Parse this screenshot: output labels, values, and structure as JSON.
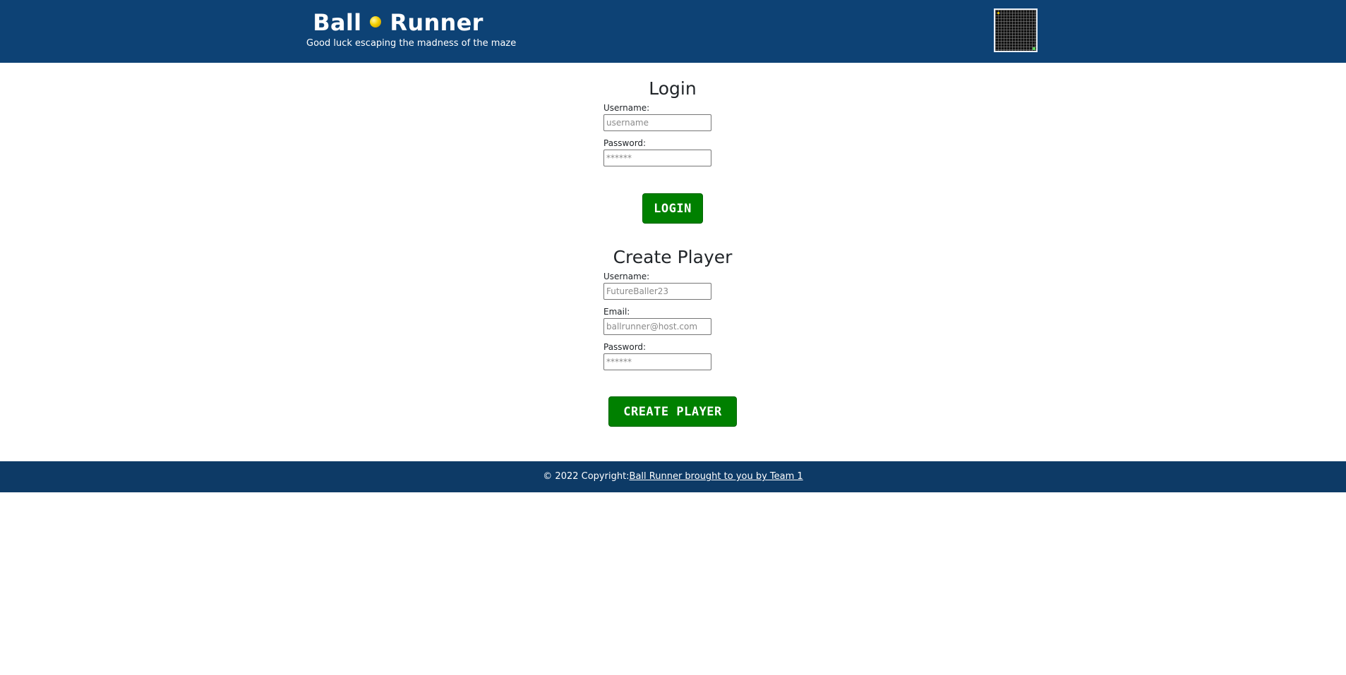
{
  "header": {
    "title_left": "Ball",
    "title_right": "Runner",
    "tagline": "Good luck escaping the madness of the maze"
  },
  "login": {
    "heading": "Login",
    "username_label": "Username:",
    "username_placeholder": "username",
    "password_label": "Password:",
    "password_placeholder": "******",
    "button_label": "LOGIN"
  },
  "create_player": {
    "heading": "Create Player",
    "username_label": "Username:",
    "username_placeholder": "FutureBaller23",
    "email_label": "Email:",
    "email_placeholder": "ballrunner@host.com",
    "password_label": "Password:",
    "password_placeholder": "******",
    "button_label": "CREATE PLAYER"
  },
  "footer": {
    "copyright": "© 2022 Copyright:",
    "link_text": "Ball Runner brought to you by Team 1"
  },
  "colors": {
    "header_bg": "#0d4275",
    "footer_bg": "#0d3a66",
    "button_bg": "#008000",
    "ball": "#f5d000"
  },
  "icons": {
    "ball": "yellow-ball-icon",
    "maze": "maze-thumbnail"
  }
}
